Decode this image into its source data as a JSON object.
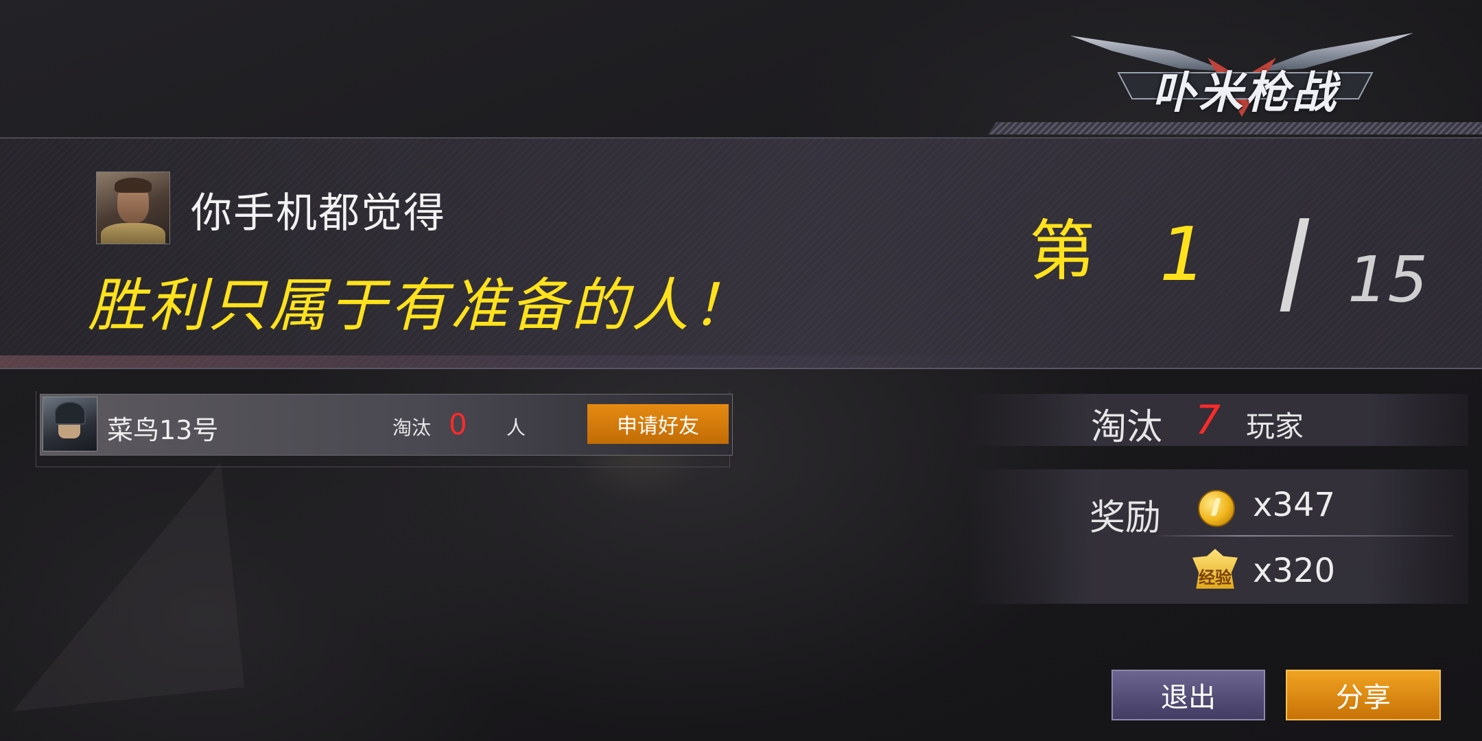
{
  "logo": {
    "text": "卟米枪战",
    "icon": "game-logo"
  },
  "header": {
    "line1": "你手机都觉得",
    "line2": "胜利只属于有准备的人！"
  },
  "rank": {
    "prefix": "第",
    "position": "1",
    "total": "15"
  },
  "player": {
    "name": "菜鸟13号",
    "kill_label": "淘汰",
    "kill_value": "0",
    "kill_unit": "人",
    "friend_button": "申请好友"
  },
  "stats": {
    "elim_label": "淘汰",
    "elim_value": "7",
    "elim_unit": "玩家",
    "reward_label": "奖励",
    "coin_amount": "x347",
    "coin_icon": "gold-coin-icon",
    "exp_amount": "x320",
    "exp_icon_text": "经验",
    "exp_icon": "exp-badge-icon"
  },
  "buttons": {
    "exit": "退出",
    "share": "分享"
  },
  "colors": {
    "highlight_yellow": "#ffe21c",
    "kill_red": "#ff2a2a",
    "friend_orange": "#e58a12",
    "exit_purple": "#5a547a",
    "share_orange": "#e08f16"
  }
}
